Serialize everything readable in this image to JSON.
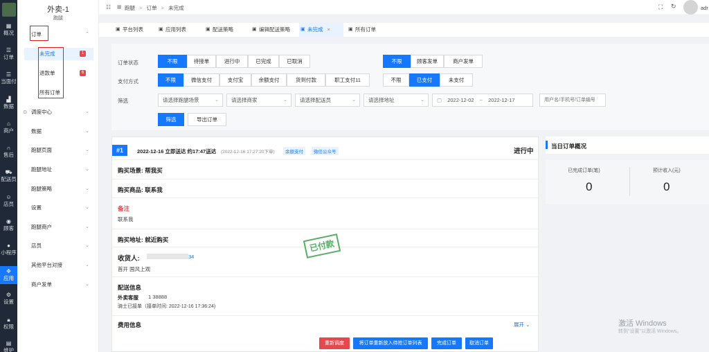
{
  "rail": {
    "items": [
      {
        "label": "概况",
        "icon": "grid-icon"
      },
      {
        "label": "订单",
        "icon": "list-icon"
      },
      {
        "label": "当面付",
        "icon": "list-icon"
      },
      {
        "label": "数据",
        "icon": "chart-icon"
      },
      {
        "label": "商户",
        "icon": "store-icon"
      },
      {
        "label": "售后",
        "icon": "headset-icon"
      },
      {
        "label": "配送员",
        "icon": "rider-icon"
      },
      {
        "label": "店员",
        "icon": "user-icon"
      },
      {
        "label": "顾客",
        "icon": "customer-icon"
      },
      {
        "label": "小程序",
        "icon": "chat-icon"
      },
      {
        "label": "应用",
        "icon": "apps-icon"
      },
      {
        "label": "设置",
        "icon": "gear-icon"
      },
      {
        "label": "权限",
        "icon": "lock-icon"
      },
      {
        "label": "维护",
        "icon": "doc-icon"
      }
    ],
    "active_index": 10,
    "accent": "#1677ff"
  },
  "sidebar": {
    "shop_name": "外卖-1",
    "shop_sub": "跑腿",
    "order_group": "订单",
    "order_sub": [
      {
        "label": "未完成",
        "badge": "1"
      },
      {
        "label": "退款单",
        "badge": "6"
      },
      {
        "label": "所有订单",
        "badge": ""
      }
    ],
    "menu": [
      "调度中心",
      "数据",
      "跑腿页面",
      "跑腿地址",
      "跑腿策略",
      "设置",
      "跑腿商户",
      "店员",
      "其他平台对接",
      "商户发单"
    ]
  },
  "header": {
    "breadcrumb": [
      "跑腿",
      "订单",
      "未完成"
    ],
    "user": "adr"
  },
  "tabs": [
    {
      "label": "平台列表"
    },
    {
      "label": "应用列表"
    },
    {
      "label": "配送策略"
    },
    {
      "label": "编辑配送策略"
    },
    {
      "label": "未完成",
      "close": "×"
    },
    {
      "label": "所有订单"
    }
  ],
  "filter": {
    "status_label": "订单状态",
    "status": [
      "不限",
      "待接单",
      "进行中",
      "已完成",
      "已取消"
    ],
    "source": [
      "不限",
      "顾客发单",
      "商户发单"
    ],
    "pay_label": "支付方式",
    "pay": [
      "不限",
      "微信支付",
      "支付宝",
      "余额支付",
      "货到付款",
      "职工支付11"
    ],
    "paid": [
      "不限",
      "已支付",
      "未支付"
    ],
    "screen_label": "筛选",
    "selects": [
      "请选择跑腿场景",
      "请选择商家",
      "请选择配送员",
      "请选择地址"
    ],
    "date_from": "2022-12-02",
    "date_sep": "~",
    "date_to": "2022-12-17",
    "search_placeholder": "用户名/手机号/订单编号",
    "filter_btn": "筛选",
    "export_btn": "导出订单"
  },
  "order": {
    "index": "#1",
    "time": "2022-12-16 立即送达 约17:47送达",
    "created": "(2022-12-16 17:27:20下单)",
    "tags": [
      "余额支付",
      "微信公众号"
    ],
    "status": "进行中",
    "scene": "购买场景: 帮我买",
    "goods": "购买商品: 联系我",
    "remark_title": "备注",
    "remark": "联系我",
    "address": "购买地址: 就近购买",
    "receiver_label": "收货人:",
    "receiver_phone": "34",
    "receiver_addr": "首开 国风上观",
    "delivery_title": "配送信息",
    "rider_name": "外卖客服",
    "rider_phone": "1       38888",
    "rider_status": "骑士已接单（接单时间: 2022-12-16 17:36:24)",
    "fee_title": "费用信息",
    "expand": "展开",
    "stamp": "已付款",
    "actions": [
      "重新调度",
      "将订单重新放入待抢订单列表",
      "完成订单",
      "取消订单"
    ]
  },
  "summary": {
    "title": "当日订单概况",
    "completed_label": "已完成订单(笔)",
    "completed_value": "0",
    "income_label": "预计收入(元)",
    "income_value": "0"
  },
  "watermark": {
    "line1": "激活 Windows",
    "line2": "转到\"设置\"以激活 Windows。"
  }
}
